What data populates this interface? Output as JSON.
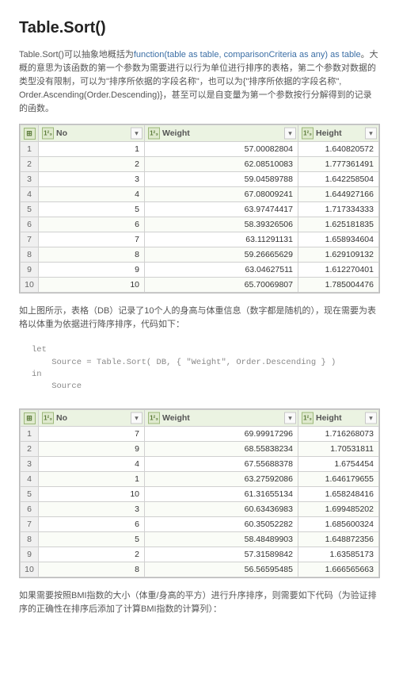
{
  "title": "Table.Sort()",
  "para1_a": "Table.Sort()可以抽象地概括为",
  "para1_sig": "function(table as table, comparisonCriteria as any) as table",
  "para1_b": "。大概的意思为该函数的第一个参数为需要进行以行为单位进行排序的表格，第二个参数对数据的类型没有限制，可以为\"排序所依据的字段名称\"，也可以为{\"排序所依据的字段名称\", Order.Ascending(Order.Descending)}，甚至可以是自变量为第一个参数按行分解得到的记录的函数。",
  "para2": "如上图所示，表格（DB）记录了10个人的身高与体重信息（数字都是随机的），现在需要为表格以体重为依据进行降序排序，代码如下：",
  "code": "let\n    Source = Table.Sort( DB, { \"Weight\", Order.Descending } )\nin\n    Source",
  "para3": "如果需要按照BMI指数的大小（体重/身高的平方）进行升序排序，则需要如下代码（为验证排序的正确性在排序后添加了计算BMI指数的计算列）：",
  "icons": {
    "table": "⊞",
    "number": "1²₃",
    "dropdown": "▾"
  },
  "columns": [
    "No",
    "Weight",
    "Height"
  ],
  "chart_data": [
    {
      "type": "table",
      "title": "DB (unsorted)",
      "columns": [
        "No",
        "Weight",
        "Height"
      ],
      "rows": [
        {
          "idx": 1,
          "No": 1,
          "Weight": "57.00082804",
          "Height": "1.640820572"
        },
        {
          "idx": 2,
          "No": 2,
          "Weight": "62.08510083",
          "Height": "1.777361491"
        },
        {
          "idx": 3,
          "No": 3,
          "Weight": "59.04589788",
          "Height": "1.642258504"
        },
        {
          "idx": 4,
          "No": 4,
          "Weight": "67.08009241",
          "Height": "1.644927166"
        },
        {
          "idx": 5,
          "No": 5,
          "Weight": "63.97474417",
          "Height": "1.717334333"
        },
        {
          "idx": 6,
          "No": 6,
          "Weight": "58.39326506",
          "Height": "1.625181835"
        },
        {
          "idx": 7,
          "No": 7,
          "Weight": "63.11291131",
          "Height": "1.658934604"
        },
        {
          "idx": 8,
          "No": 8,
          "Weight": "59.26665629",
          "Height": "1.629109132"
        },
        {
          "idx": 9,
          "No": 9,
          "Weight": "63.04627511",
          "Height": "1.612270401"
        },
        {
          "idx": 10,
          "No": 10,
          "Weight": "65.70069807",
          "Height": "1.785004476"
        }
      ]
    },
    {
      "type": "table",
      "title": "Source (sorted by Weight desc)",
      "columns": [
        "No",
        "Weight",
        "Height"
      ],
      "rows": [
        {
          "idx": 1,
          "No": 7,
          "Weight": "69.99917296",
          "Height": "1.716268073"
        },
        {
          "idx": 2,
          "No": 9,
          "Weight": "68.55838234",
          "Height": "1.70531811"
        },
        {
          "idx": 3,
          "No": 4,
          "Weight": "67.55688378",
          "Height": "1.6754454"
        },
        {
          "idx": 4,
          "No": 1,
          "Weight": "63.27592086",
          "Height": "1.646179655"
        },
        {
          "idx": 5,
          "No": 10,
          "Weight": "61.31655134",
          "Height": "1.658248416"
        },
        {
          "idx": 6,
          "No": 3,
          "Weight": "60.63436983",
          "Height": "1.699485202"
        },
        {
          "idx": 7,
          "No": 6,
          "Weight": "60.35052282",
          "Height": "1.685600324"
        },
        {
          "idx": 8,
          "No": 5,
          "Weight": "58.48489903",
          "Height": "1.648872356"
        },
        {
          "idx": 9,
          "No": 2,
          "Weight": "57.31589842",
          "Height": "1.63585173"
        },
        {
          "idx": 10,
          "No": 8,
          "Weight": "56.56595485",
          "Height": "1.666565663"
        }
      ]
    }
  ]
}
